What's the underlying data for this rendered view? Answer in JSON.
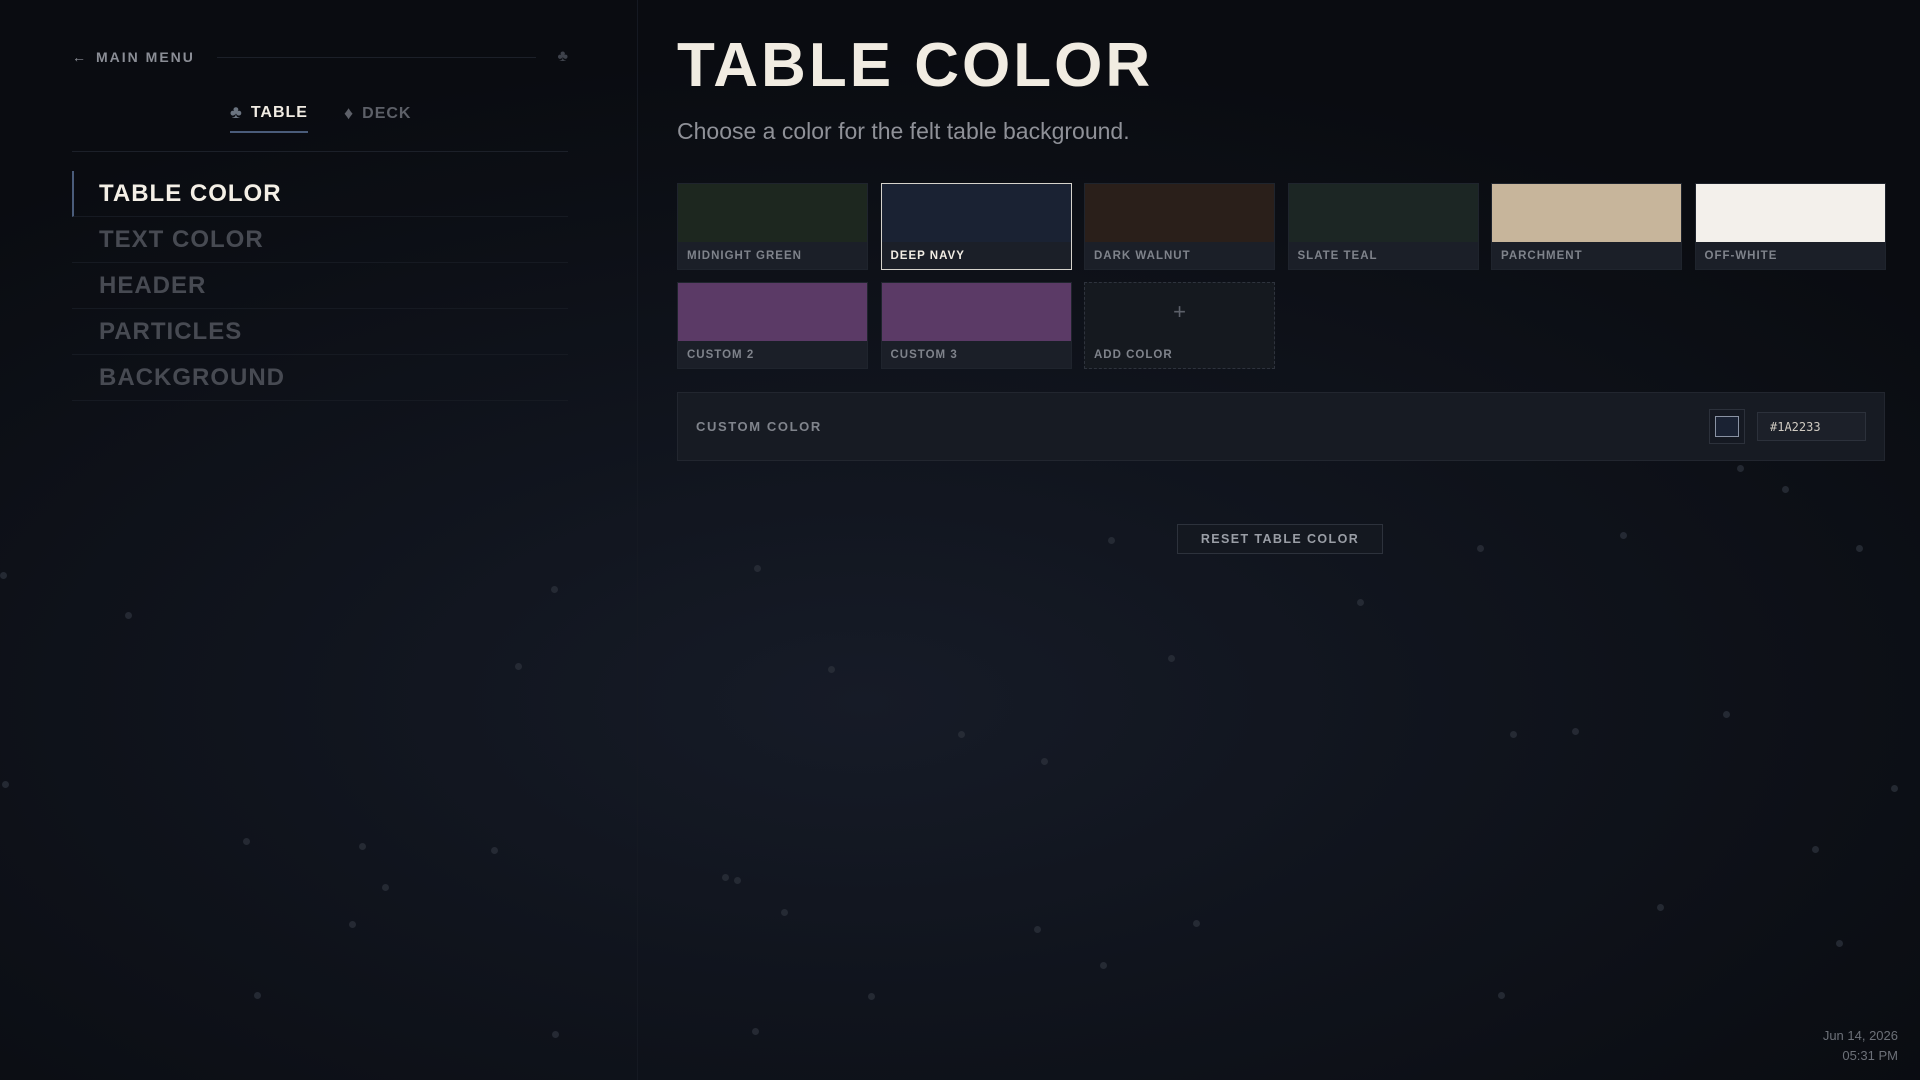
{
  "sidebar": {
    "back_label": "MAIN MENU",
    "tabs": [
      {
        "label": "TABLE",
        "icon": "club-icon",
        "active": true
      },
      {
        "label": "DECK",
        "icon": "diamond-icon",
        "active": false
      }
    ],
    "items": [
      {
        "label": "TABLE COLOR",
        "active": true
      },
      {
        "label": "TEXT COLOR",
        "active": false
      },
      {
        "label": "HEADER",
        "active": false
      },
      {
        "label": "PARTICLES",
        "active": false
      },
      {
        "label": "BACKGROUND",
        "active": false
      }
    ]
  },
  "main": {
    "title": "TABLE COLOR",
    "subtitle": "Choose a color for the felt table background.",
    "swatches": [
      {
        "label": "MIDNIGHT GREEN",
        "color": "#1d271f",
        "selected": false
      },
      {
        "label": "DEEP NAVY",
        "color": "#1a2233",
        "selected": true
      },
      {
        "label": "DARK WALNUT",
        "color": "#2a1f1a",
        "selected": false
      },
      {
        "label": "SLATE TEAL",
        "color": "#1c2624",
        "selected": false
      },
      {
        "label": "PARCHMENT",
        "color": "#c7b59b",
        "selected": false
      },
      {
        "label": "OFF-WHITE",
        "color": "#f3f0eb",
        "selected": false
      },
      {
        "label": "CUSTOM 2",
        "color": "#5b3a66",
        "selected": false
      },
      {
        "label": "CUSTOM 3",
        "color": "#5b3a66",
        "selected": false
      }
    ],
    "add_swatch": {
      "label": "ADD COLOR",
      "symbol": "+"
    },
    "custom_color": {
      "label": "CUSTOM COLOR",
      "hex": "#1A2233",
      "well_color": "#1a2233"
    },
    "reset_label": "RESET TABLE COLOR"
  },
  "clock": {
    "date": "Jun 14, 2026",
    "time": "05:31 PM"
  },
  "colors": {
    "accent": "#4a5c7a",
    "text_primary": "#f1ece2",
    "text_muted": "#474a52"
  }
}
